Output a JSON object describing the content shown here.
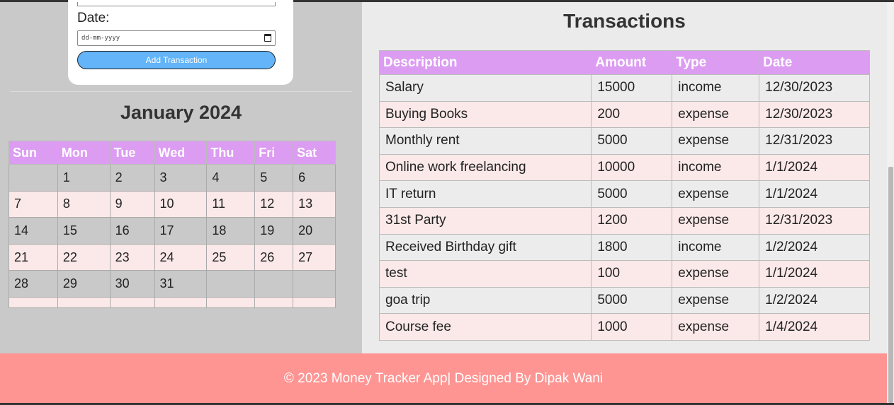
{
  "form": {
    "date_label": "Date:",
    "date_placeholder": "dd-mm-yyyy",
    "add_button": "Add Transaction"
  },
  "calendar": {
    "title": "January 2024",
    "weekdays": [
      "Sun",
      "Mon",
      "Tue",
      "Wed",
      "Thu",
      "Fri",
      "Sat"
    ],
    "weeks": [
      [
        "",
        "1",
        "2",
        "3",
        "4",
        "5",
        "6"
      ],
      [
        "7",
        "8",
        "9",
        "10",
        "11",
        "12",
        "13"
      ],
      [
        "14",
        "15",
        "16",
        "17",
        "18",
        "19",
        "20"
      ],
      [
        "21",
        "22",
        "23",
        "24",
        "25",
        "26",
        "27"
      ],
      [
        "28",
        "29",
        "30",
        "31",
        "",
        "",
        ""
      ],
      [
        "",
        "",
        "",
        "",
        "",
        "",
        ""
      ]
    ]
  },
  "transactions": {
    "title": "Transactions",
    "headers": [
      "Description",
      "Amount",
      "Type",
      "Date"
    ],
    "rows": [
      [
        "Salary",
        "15000",
        "income",
        "12/30/2023"
      ],
      [
        "Buying Books",
        "200",
        "expense",
        "12/30/2023"
      ],
      [
        "Monthly rent",
        "5000",
        "expense",
        "12/31/2023"
      ],
      [
        "Online work freelancing",
        "10000",
        "income",
        "1/1/2024"
      ],
      [
        "IT return",
        "5000",
        "expense",
        "1/1/2024"
      ],
      [
        "31st Party",
        "1200",
        "expense",
        "12/31/2023"
      ],
      [
        "Received Birthday gift",
        "1800",
        "income",
        "1/2/2024"
      ],
      [
        "test",
        "100",
        "expense",
        "1/1/2024"
      ],
      [
        "goa trip",
        "5000",
        "expense",
        "1/2/2024"
      ],
      [
        "Course fee",
        "1000",
        "expense",
        "1/4/2024"
      ]
    ]
  },
  "footer": {
    "text": "© 2023 Money Tracker App| Designed By Dipak Wani"
  },
  "colors": {
    "header_purple": "#dc9cf2",
    "button_blue": "#63b4f8",
    "footer_pink": "#ff9593",
    "row_pink": "#fae9e8"
  }
}
